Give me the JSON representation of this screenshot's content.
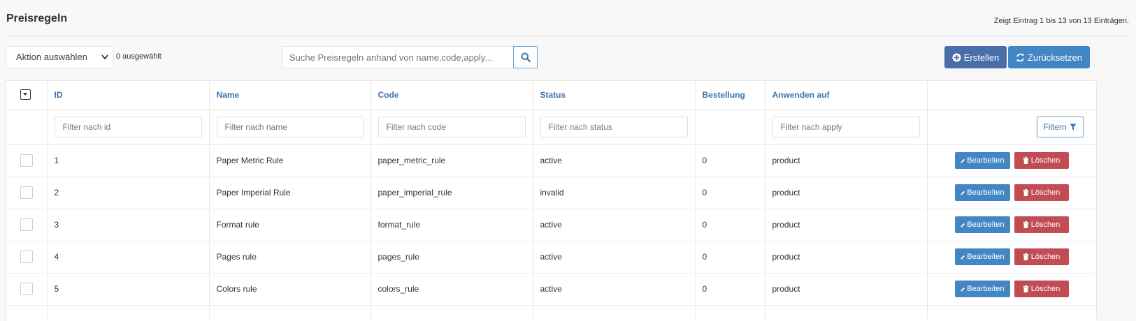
{
  "header": {
    "title": "Preisregeln",
    "entries_info": "Zeigt Eintrag 1 bis 13 von 13 Einträgen."
  },
  "toolbar": {
    "action_select_value": "Aktion auswählen",
    "selected_count": "0 ausgewählt",
    "search_placeholder": "Suche Preisregeln anhand von name,code,apply...",
    "create_label": "Erstellen",
    "reset_label": "Zurücksetzen"
  },
  "table": {
    "columns": [
      "ID",
      "Name",
      "Code",
      "Status",
      "Bestellung",
      "Anwenden auf"
    ],
    "filters": {
      "id": "Filter nach id",
      "name": "Filter nach name",
      "code": "Filter nach code",
      "status": "Filter nach status",
      "apply": "Filter nach apply",
      "button_label": "Filtern"
    },
    "rows": [
      {
        "id": "1",
        "name": "Paper Metric Rule",
        "code": "paper_metric_rule",
        "status": "active",
        "order": "0",
        "apply": "product"
      },
      {
        "id": "2",
        "name": "Paper Imperial Rule",
        "code": "paper_imperial_rule",
        "status": "invalid",
        "order": "0",
        "apply": "product"
      },
      {
        "id": "3",
        "name": "Format rule",
        "code": "format_rule",
        "status": "active",
        "order": "0",
        "apply": "product"
      },
      {
        "id": "4",
        "name": "Pages rule",
        "code": "pages_rule",
        "status": "active",
        "order": "0",
        "apply": "product"
      },
      {
        "id": "5",
        "name": "Colors rule",
        "code": "colors_rule",
        "status": "active",
        "order": "0",
        "apply": "product"
      }
    ],
    "edit_label": "Bearbeiten",
    "delete_label": "Löschen"
  },
  "colors": {
    "accent": "#4386c6",
    "create": "#4a6ea9",
    "delete": "#c14c56",
    "header_text": "#3a74ad"
  }
}
